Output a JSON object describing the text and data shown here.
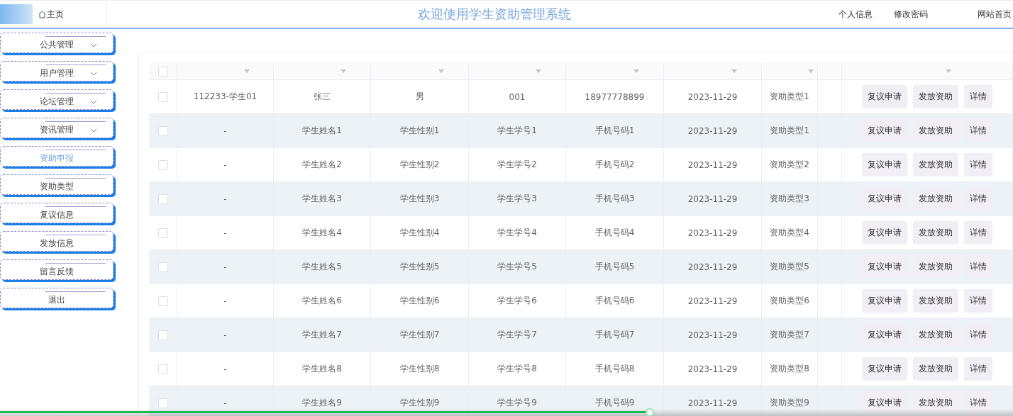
{
  "header": {
    "home": "主页",
    "title": "欢迎使用学生资助管理系统",
    "links": [
      "个人信息",
      "修改密码",
      "网站首页"
    ]
  },
  "sidebar": {
    "items": [
      {
        "label": "公共管理",
        "expandable": true,
        "selected": false
      },
      {
        "label": "用户管理",
        "expandable": true,
        "selected": false
      },
      {
        "label": "论坛管理",
        "expandable": true,
        "selected": false
      },
      {
        "label": "资讯管理",
        "expandable": true,
        "selected": false
      },
      {
        "label": "资助申报",
        "expandable": false,
        "selected": true
      },
      {
        "label": "资助类型",
        "expandable": false,
        "selected": false
      },
      {
        "label": "复议信息",
        "expandable": false,
        "selected": false
      },
      {
        "label": "发放信息",
        "expandable": false,
        "selected": false
      },
      {
        "label": "留言反馈",
        "expandable": false,
        "selected": false
      },
      {
        "label": "退出",
        "expandable": false,
        "selected": false
      }
    ]
  },
  "table": {
    "all_checked": false,
    "rows": [
      {
        "checked": false,
        "cells": [
          "112233-学生01",
          "张三",
          "男",
          "001",
          "18977778899",
          "2023-11-29",
          "资助类型1"
        ],
        "actions": [
          "复议申请",
          "发放资助",
          "详情"
        ]
      },
      {
        "checked": false,
        "cells": [
          "-",
          "学生姓名1",
          "学生性别1",
          "学生学号1",
          "手机号码1",
          "2023-11-29",
          "资助类型1"
        ],
        "actions": [
          "复议申请",
          "发放资助",
          "详情"
        ]
      },
      {
        "checked": false,
        "cells": [
          "-",
          "学生姓名2",
          "学生性别2",
          "学生学号2",
          "手机号码2",
          "2023-11-29",
          "资助类型2"
        ],
        "actions": [
          "复议申请",
          "发放资助",
          "详情"
        ]
      },
      {
        "checked": false,
        "cells": [
          "-",
          "学生姓名3",
          "学生性别3",
          "学生学号3",
          "手机号码3",
          "2023-11-29",
          "资助类型3"
        ],
        "actions": [
          "复议申请",
          "发放资助",
          "详情"
        ]
      },
      {
        "checked": false,
        "cells": [
          "-",
          "学生姓名4",
          "学生性别4",
          "学生学号4",
          "手机号码4",
          "2023-11-29",
          "资助类型4"
        ],
        "actions": [
          "复议申请",
          "发放资助",
          "详情"
        ]
      },
      {
        "checked": false,
        "cells": [
          "-",
          "学生姓名5",
          "学生性别5",
          "学生学号5",
          "手机号码5",
          "2023-11-29",
          "资助类型5"
        ],
        "actions": [
          "复议申请",
          "发放资助",
          "详情"
        ]
      },
      {
        "checked": false,
        "cells": [
          "-",
          "学生姓名6",
          "学生性别6",
          "学生学号6",
          "手机号码6",
          "2023-11-29",
          "资助类型6"
        ],
        "actions": [
          "复议申请",
          "发放资助",
          "详情"
        ]
      },
      {
        "checked": false,
        "cells": [
          "-",
          "学生姓名7",
          "学生性别7",
          "学生学号7",
          "手机号码7",
          "2023-11-29",
          "资助类型7"
        ],
        "actions": [
          "复议申请",
          "发放资助",
          "详情"
        ]
      },
      {
        "checked": false,
        "cells": [
          "-",
          "学生姓名8",
          "学生性别8",
          "学生学号8",
          "手机号码8",
          "2023-11-29",
          "资助类型8"
        ],
        "actions": [
          "复议申请",
          "发放资助",
          "详情"
        ]
      },
      {
        "checked": false,
        "cells": [
          "-",
          "学生姓名9",
          "学生性别9",
          "学生学号9",
          "手机号码9",
          "2023-11-29",
          "资助类型9"
        ],
        "actions": [
          "复议申请",
          "发放资助",
          "详情"
        ]
      }
    ]
  },
  "player": {
    "level": 0.643
  }
}
